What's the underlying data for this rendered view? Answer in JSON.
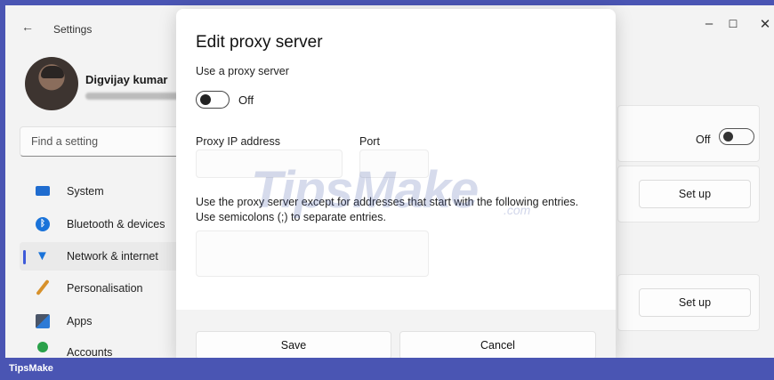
{
  "window": {
    "app_title": "Settings",
    "back_glyph": "←",
    "minimize_glyph": "–",
    "maximize_glyph": "☐",
    "close_glyph": "✕"
  },
  "profile": {
    "name": "Digvijay kumar"
  },
  "search": {
    "placeholder": "Find a setting"
  },
  "nav": [
    {
      "label": "System",
      "icon": "system-icon"
    },
    {
      "label": "Bluetooth & devices",
      "icon": "bluetooth-icon"
    },
    {
      "label": "Network & internet",
      "icon": "wifi-icon",
      "active": true
    },
    {
      "label": "Personalisation",
      "icon": "brush-icon"
    },
    {
      "label": "Apps",
      "icon": "apps-icon"
    },
    {
      "label": "Accounts",
      "icon": "account-icon"
    }
  ],
  "right_panel": {
    "toggle_label": "Off",
    "setup_buttons": [
      "Set up",
      "Set up"
    ]
  },
  "dialog": {
    "title": "Edit proxy server",
    "use_proxy_label": "Use a proxy server",
    "toggle_state": "Off",
    "ip_label": "Proxy IP address",
    "port_label": "Port",
    "exceptions_line1": "Use the proxy server except for addresses that start with the following entries.",
    "exceptions_line2": "Use semicolons (;) to separate entries.",
    "save_label": "Save",
    "cancel_label": "Cancel"
  },
  "watermark": {
    "text": "TipsMake",
    "suffix": ".com"
  },
  "footer": {
    "brand": "TipsMake"
  },
  "colors": {
    "accent": "#3f5bd9",
    "frame": "#4a55b3"
  }
}
